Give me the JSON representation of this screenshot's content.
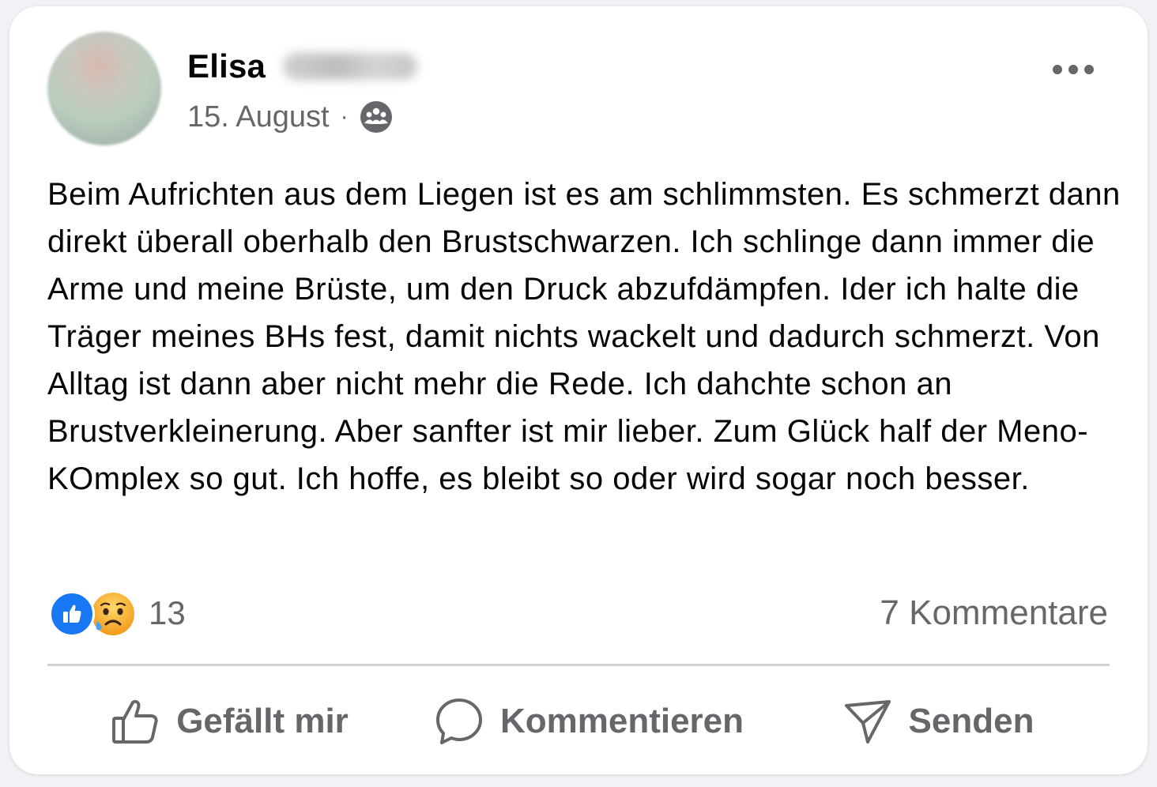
{
  "post": {
    "author_first_name": "Elisa",
    "date": "15. August",
    "meta_separator": "·",
    "audience_icon": "group-icon",
    "more_icon": "more-options-icon",
    "text": "Beim Aufrichten aus dem Liegen ist es am schlimmsten. Es schmerzt dann direkt überall oberhalb den Brustschwarzen. Ich schlinge dann immer die Arme und meine Brüste, um den Druck abzufdämpfen. Ider ich halte die Träger meines BHs fest, damit nichts wackelt und dadurch schmerzt. Von Alltag ist dann aber nicht mehr die Rede. Ich dahchte schon an Brustverkleinerung. Aber sanfter ist mir lieber. Zum Glück half der Meno-KOmplex so gut. Ich hoffe, es bleibt so oder wird sogar noch besser."
  },
  "stats": {
    "reaction_icons": [
      "like-icon",
      "sad-icon"
    ],
    "reaction_count": "13",
    "comments": "7 Kommentare"
  },
  "actions": {
    "like_label": "Gefällt mir",
    "comment_label": "Kommentieren",
    "send_label": "Senden"
  },
  "colors": {
    "accent": "#1877f2",
    "secondary_text": "#65676b",
    "primary_text": "#050505",
    "divider": "#ced0d4",
    "sad_emoji": "#f7b125"
  }
}
